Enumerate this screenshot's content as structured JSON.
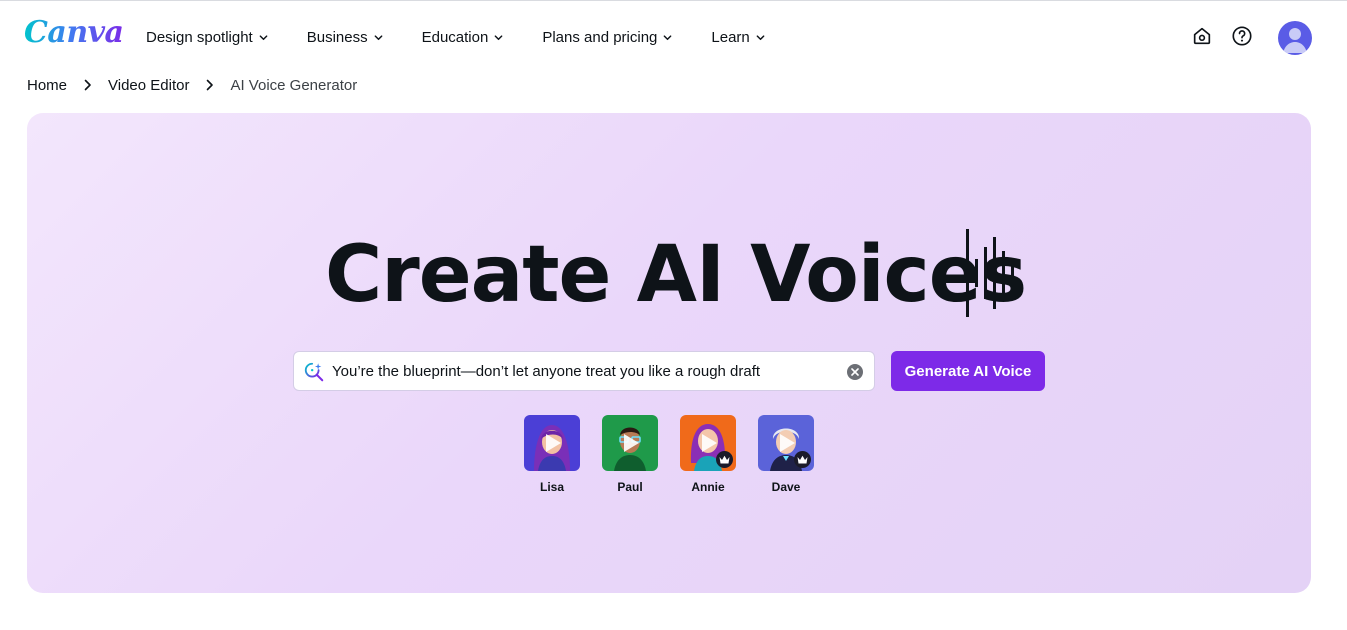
{
  "brand": {
    "logo_text": "Canva"
  },
  "nav": {
    "items": [
      {
        "label": "Design spotlight"
      },
      {
        "label": "Business"
      },
      {
        "label": "Education"
      },
      {
        "label": "Plans and pricing"
      },
      {
        "label": "Learn"
      }
    ]
  },
  "header_icons": [
    "home-icon",
    "help-icon",
    "avatar"
  ],
  "breadcrumb": {
    "items": [
      "Home",
      "Video Editor",
      "AI Voice Generator"
    ]
  },
  "hero": {
    "title": "Create AI Voices",
    "search": {
      "value": "You’re the blueprint—don’t let anyone treat you like a rough draft",
      "icon": "sparkle-search-icon"
    },
    "generate_label": "Generate AI Voice",
    "voices": [
      {
        "name": "Lisa",
        "premium": false,
        "bg": "#4b3fd6"
      },
      {
        "name": "Paul",
        "premium": false,
        "bg": "#1f9a4a"
      },
      {
        "name": "Annie",
        "premium": true,
        "bg": "#f06a1a"
      },
      {
        "name": "Dave",
        "premium": true,
        "bg": "#5b63d9"
      }
    ]
  },
  "colors": {
    "accent": "#7d2ae8",
    "hero_bg": "#ead7fa",
    "text": "#0e1318"
  }
}
